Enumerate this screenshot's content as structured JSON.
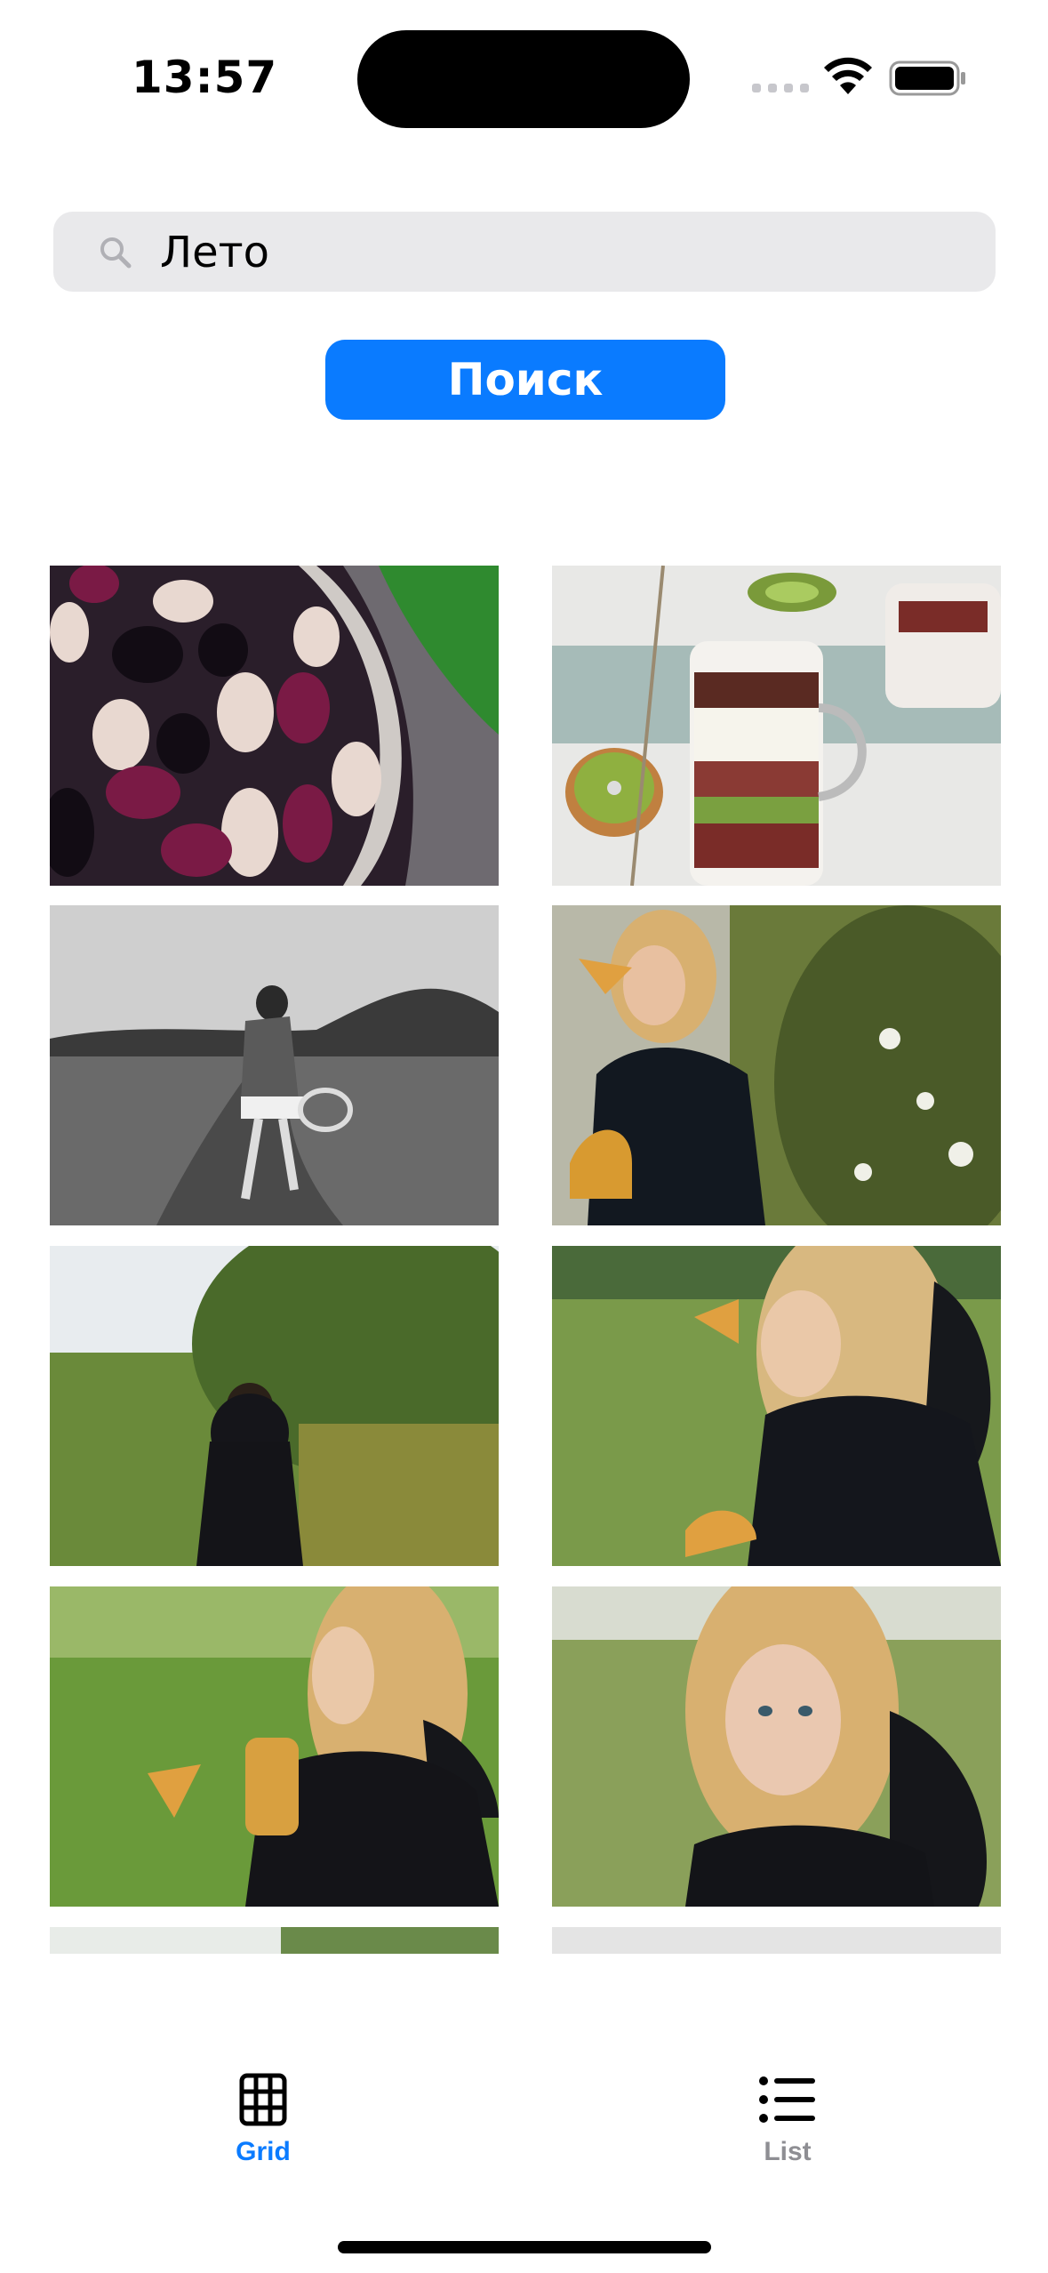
{
  "status_bar": {
    "time": "13:57"
  },
  "search": {
    "value": "Лето",
    "button_label": "Поиск"
  },
  "grid": {
    "photos": [
      {
        "subject": "mulberries in a bowl"
      },
      {
        "subject": "layered dessert in a glass with kiwi"
      },
      {
        "subject": "black and white person running on a field path"
      },
      {
        "subject": "woman in black dress holding chanterelles"
      },
      {
        "subject": "woman with hat walking in a field"
      },
      {
        "subject": "woman smelling a mushroom"
      },
      {
        "subject": "woman holding a jar of mushrooms"
      },
      {
        "subject": "woman portrait in field"
      }
    ]
  },
  "tab_bar": {
    "tabs": [
      {
        "label": "Grid",
        "icon": "grid-icon",
        "active": true
      },
      {
        "label": "List",
        "icon": "list-icon",
        "active": false
      }
    ]
  },
  "colors": {
    "accent": "#0a7bff",
    "search_bg": "#e9e9eb",
    "inactive_tab": "#8e8e93"
  }
}
